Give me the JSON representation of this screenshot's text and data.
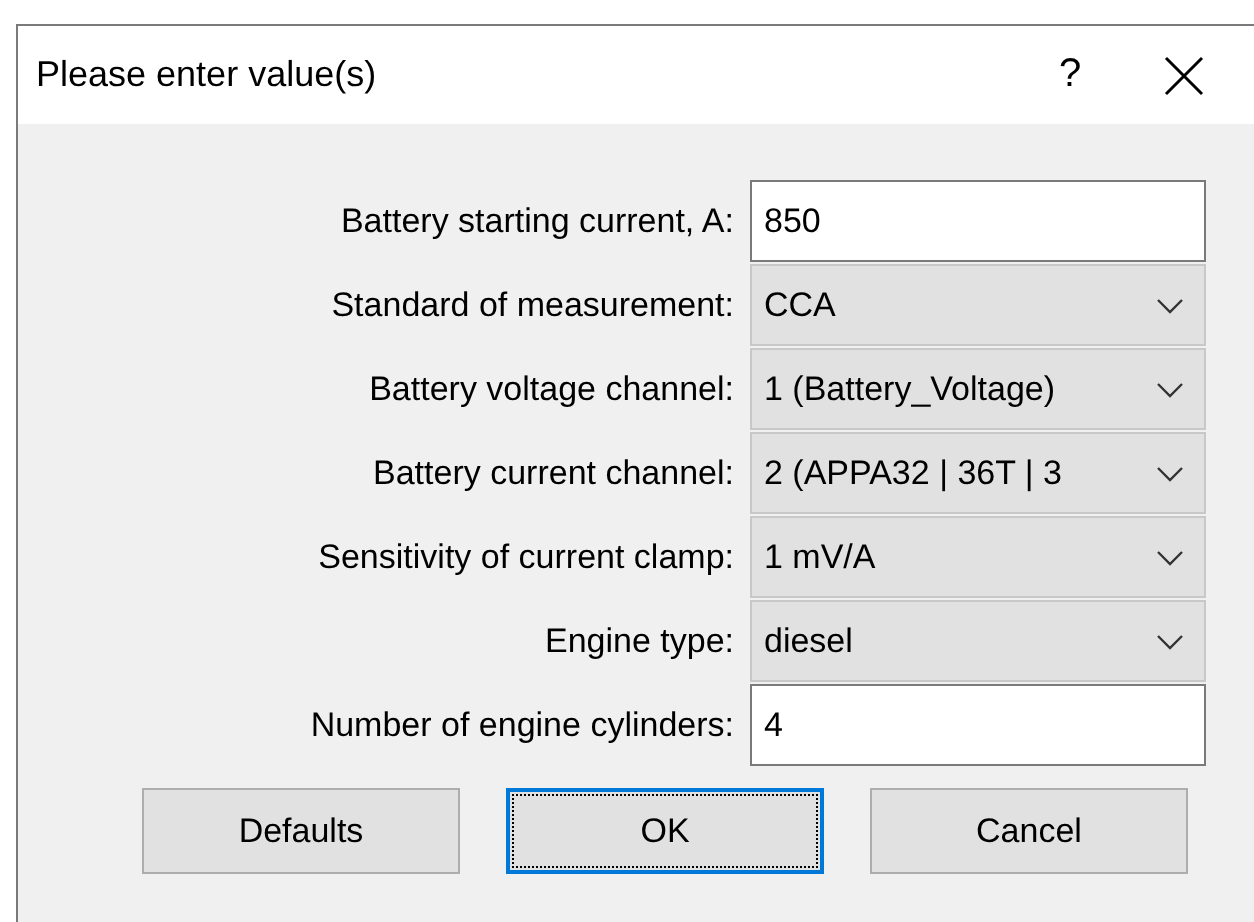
{
  "window": {
    "title": "Please enter value(s)",
    "help": "?"
  },
  "fields": [
    {
      "label": "Battery starting current, A:",
      "kind": "text",
      "value": "850"
    },
    {
      "label": "Standard of measurement:",
      "kind": "dropdown",
      "value": "CCA"
    },
    {
      "label": "Battery voltage channel:",
      "kind": "dropdown",
      "value": "1 (Battery_Voltage)"
    },
    {
      "label": "Battery current channel:",
      "kind": "dropdown",
      "value": "2 (APPA32 | 36T | 3"
    },
    {
      "label": "Sensitivity of current clamp:",
      "kind": "dropdown",
      "value": "1 mV/A"
    },
    {
      "label": "Engine type:",
      "kind": "dropdown",
      "value": "diesel"
    },
    {
      "label": "Number of engine cylinders:",
      "kind": "text",
      "value": "4"
    }
  ],
  "buttons": [
    {
      "label": "Defaults",
      "focused": false
    },
    {
      "label": "OK",
      "focused": true
    },
    {
      "label": "Cancel",
      "focused": false
    }
  ]
}
